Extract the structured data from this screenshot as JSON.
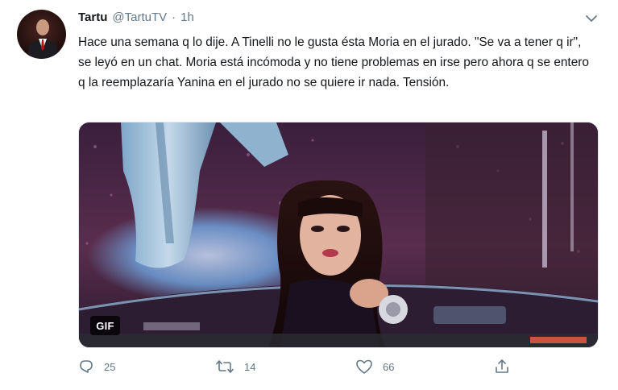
{
  "tweet": {
    "author": {
      "display_name": "Tartu",
      "handle": "@TartuTV",
      "separator": "·",
      "time": "1h"
    },
    "text": "Hace una semana q lo dije. A Tinelli no le gusta ésta Moria en el jurado. \"Se va a tener q ir\", se leyó en un chat. Moria está incómoda y no tiene problemas en irse pero ahora q se entero q la reemplazaría Yanina en el jurado no se quiere ir nada. Tensión.",
    "media": {
      "badge": "GIF",
      "type": "gif"
    },
    "actions": {
      "replies": "25",
      "retweets": "14",
      "likes": "66"
    },
    "icons": {
      "caret": "chevron-down-icon",
      "reply": "reply-icon",
      "retweet": "retweet-icon",
      "like": "heart-icon",
      "share": "share-icon"
    },
    "colors": {
      "text": "#14171a",
      "secondary": "#657786"
    }
  }
}
